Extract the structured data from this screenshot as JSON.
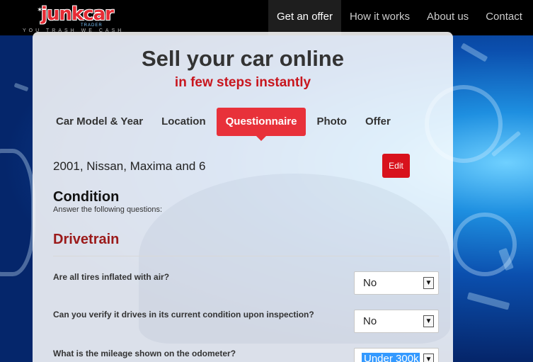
{
  "logo": {
    "name": "junkcar",
    "sub": "TRADER",
    "tagline": "YOU TRASH WE CASH"
  },
  "nav": {
    "items": [
      "Get an offer",
      "How it works",
      "About us",
      "Contact"
    ]
  },
  "panel": {
    "title": "Sell your car online",
    "subtitle": "in few steps instantly"
  },
  "steps": {
    "items": [
      "Car Model & Year",
      "Location",
      "Questionnaire",
      "Photo",
      "Offer"
    ],
    "active": "Questionnaire"
  },
  "car_summary": "2001, Nissan, Maxima and 6",
  "edit_label": "Edit",
  "condition": {
    "heading": "Condition",
    "subheading": "Answer the following questions:"
  },
  "drivetrain": {
    "heading": "Drivetrain",
    "questions": [
      {
        "text": "Are all tires inflated with air?",
        "answer": "No"
      },
      {
        "text": "Can you verify it drives in its current condition upon inspection?",
        "answer": "No"
      },
      {
        "text": "What is the mileage shown on the odometer?",
        "answer": "Under 300k"
      }
    ]
  },
  "colors": {
    "accent": "#e8313a",
    "section_heading": "#9b1a1a",
    "subtitle": "#c8161e"
  }
}
